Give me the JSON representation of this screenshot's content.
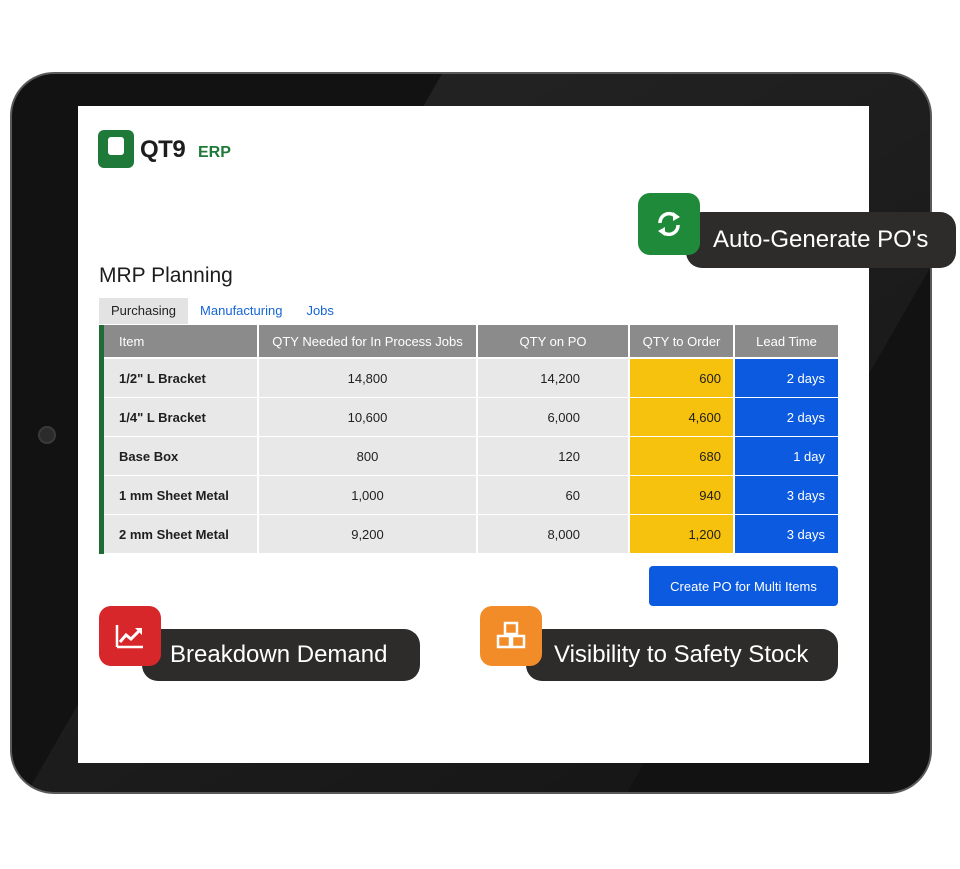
{
  "app": {
    "logo_text": "QT9",
    "logo_suffix": "ERP"
  },
  "page": {
    "title": "MRP Planning"
  },
  "tabs": [
    {
      "label": "Purchasing",
      "active": true
    },
    {
      "label": "Manufacturing",
      "active": false
    },
    {
      "label": "Jobs",
      "active": false
    }
  ],
  "table": {
    "columns": [
      "Item",
      "QTY Needed for In Process Jobs",
      "QTY on PO",
      "QTY to Order",
      "Lead Time"
    ],
    "rows": [
      {
        "item": "1/2\" L Bracket",
        "needed": "14,800",
        "on_po": "14,200",
        "to_order": "600",
        "lead_time": "2 days"
      },
      {
        "item": "1/4\" L Bracket",
        "needed": "10,600",
        "on_po": "6,000",
        "to_order": "4,600",
        "lead_time": "2 days"
      },
      {
        "item": "Base Box",
        "needed": "800",
        "on_po": "120",
        "to_order": "680",
        "lead_time": "1 day"
      },
      {
        "item": "1 mm Sheet Metal",
        "needed": "1,000",
        "on_po": "60",
        "to_order": "940",
        "lead_time": "3 days"
      },
      {
        "item": "2 mm Sheet Metal",
        "needed": "9,200",
        "on_po": "8,000",
        "to_order": "1,200",
        "lead_time": "3 days"
      }
    ]
  },
  "actions": {
    "create_po": "Create PO for Multi Items"
  },
  "callouts": {
    "auto_po": {
      "label": "Auto-Generate PO's",
      "icon": "refresh-icon"
    },
    "demand": {
      "label": "Breakdown Demand",
      "icon": "trending-chart-icon"
    },
    "stock": {
      "label": "Visibility to Safety Stock",
      "icon": "boxes-icon"
    }
  },
  "colors": {
    "brand_green": "#1f7a3a",
    "qty_to_order": "#f7c20d",
    "lead_time": "#0b5ae0",
    "header": "#8b8b8b"
  }
}
